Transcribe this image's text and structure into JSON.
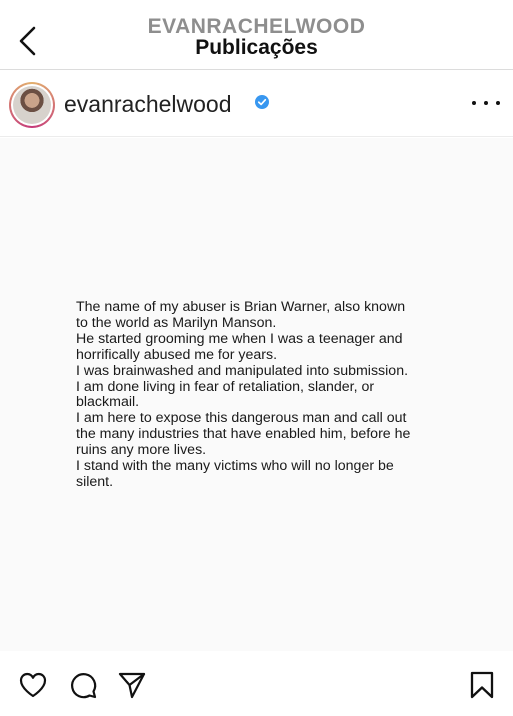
{
  "header": {
    "username": "EVANRACHELWOOD",
    "title": "Publicações"
  },
  "profile": {
    "name": "evanrachelwood"
  },
  "post": {
    "lines": [
      "The name of my abuser is Brian Warner, also known",
      "to the world as Marilyn Manson.",
      "He started grooming me when I was a teenager and",
      "horrifically abused me for years.",
      "I was brainwashed and manipulated into submission.",
      "I am done living in fear of retaliation, slander, or",
      "blackmail.",
      "I am here to expose this dangerous man and call out",
      "the many industries that have enabled him, before he",
      "ruins any more lives.",
      "I stand with the many victims who will no longer be",
      "silent."
    ]
  },
  "icons": {
    "back": "chevron-left-icon",
    "verified": "verified-badge-icon",
    "more": "more-options-icon",
    "like": "heart-icon",
    "comment": "comment-icon",
    "share": "paper-plane-icon",
    "save": "bookmark-icon"
  },
  "colors": {
    "verified": "#3897f0",
    "muted": "#8e8e8e",
    "text": "#111111"
  }
}
